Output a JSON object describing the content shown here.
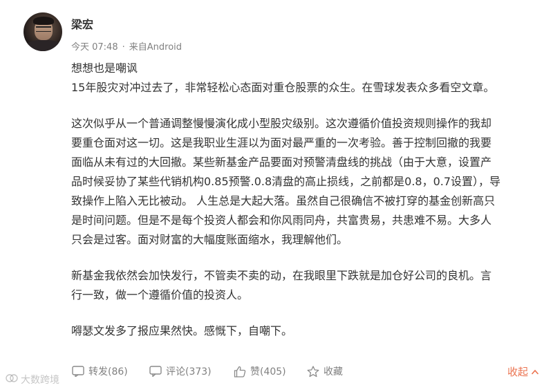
{
  "post": {
    "author": "梁宏",
    "time": "今天 07:48",
    "source": "来自Android",
    "lines": [
      "想想也是嘲讽",
      "15年股灾对冲过去了，非常轻松心态面对重仓股票的众生。在雪球发表众多看空文章。"
    ],
    "para2": [
      "这次似乎从一个普通调整慢慢演化成小型股灾级别。这次遵循价值投资规则操作的我却",
      "要重仓面对这一切。这是我职业生涯以为面对最严重的一次考验。善于控制回撤的我要",
      "面临从未有过的大回撤。某些新基金产品要面对预警清盘线的挑战（由于大意，设置产",
      "品时候妥协了某些代销机构0.85预警.0.8清盘的高止损线，之前都是0.8，0.7设置），导",
      "致操作上陷入无比被动。 人生总是大起大落。虽然自己很确信不被打穿的基金创新高只",
      "是时间问题。但是不是每个投资人都会和你风雨同舟，共富贵易，共患难不易。大多人",
      "只会是过客。面对财富的大幅度账面缩水，我理解他们。"
    ],
    "para3": [
      "新基金我依然会加快发行，不管卖不卖的动，在我眼里下跌就是加仓好公司的良机。言",
      "行一致，做一个遵循价值的投资人。"
    ],
    "para4": [
      "嘚瑟文发多了报应果然快。感慨下，自嘲下。"
    ]
  },
  "actions": {
    "repost": "转发(86)",
    "comment": "评论(373)",
    "like": "赞(405)",
    "favorite": "收藏",
    "collapse": "收起"
  },
  "watermark": "大数跨境"
}
